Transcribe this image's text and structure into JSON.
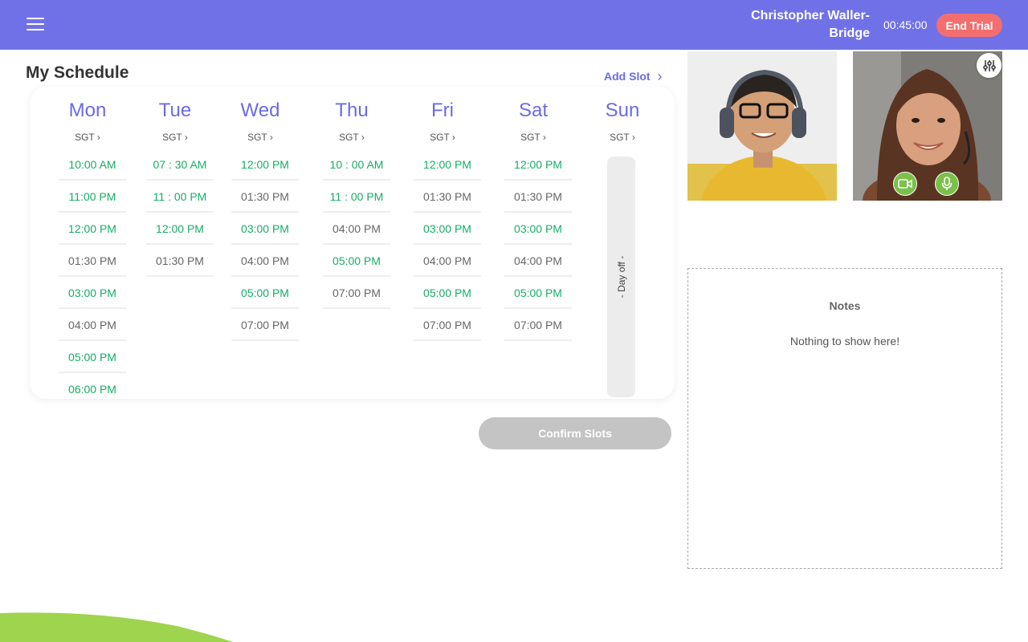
{
  "header": {
    "menu_icon": "hamburger-menu-icon",
    "user_name": "Christopher Waller-Bridge",
    "timer": "00:45:00",
    "end_trial_label": "End Trial",
    "background_color": "#7171e7",
    "end_trial_color": "#f36f6f"
  },
  "schedule": {
    "title": "My Schedule",
    "add_slot_label": "Add Slot",
    "confirm_label": "Confirm Slots",
    "days": [
      {
        "name": "Mon",
        "tz": "SGT",
        "slots": [
          {
            "time": "10:00 AM",
            "available": true
          },
          {
            "time": "11:00 PM",
            "available": true
          },
          {
            "time": "12:00 PM",
            "available": true
          },
          {
            "time": "01:30 PM",
            "available": false
          },
          {
            "time": "03:00 PM",
            "available": true
          },
          {
            "time": "04:00 PM",
            "available": false
          },
          {
            "time": "05:00 PM",
            "available": true
          },
          {
            "time": "06:00 PM",
            "available": true
          }
        ]
      },
      {
        "name": "Tue",
        "tz": "SGT",
        "slots": [
          {
            "time": "07 : 30 AM",
            "available": true
          },
          {
            "time": "11 : 00 PM",
            "available": true
          },
          {
            "time": "12:00 PM",
            "available": true
          },
          {
            "time": "01:30 PM",
            "available": false
          }
        ]
      },
      {
        "name": "Wed",
        "tz": "SGT",
        "slots": [
          {
            "time": "12:00 PM",
            "available": true
          },
          {
            "time": "01:30 PM",
            "available": false
          },
          {
            "time": "03:00 PM",
            "available": true
          },
          {
            "time": "04:00 PM",
            "available": false
          },
          {
            "time": "05:00 PM",
            "available": true
          },
          {
            "time": "07:00 PM",
            "available": false
          }
        ]
      },
      {
        "name": "Thu",
        "tz": "SGT",
        "slots": [
          {
            "time": "10 : 00 AM",
            "available": true
          },
          {
            "time": "11 : 00 PM",
            "available": true
          },
          {
            "time": "04:00 PM",
            "available": false
          },
          {
            "time": "05:00 PM",
            "available": true
          },
          {
            "time": "07:00 PM",
            "available": false
          }
        ]
      },
      {
        "name": "Fri",
        "tz": "SGT",
        "slots": [
          {
            "time": "12:00 PM",
            "available": true
          },
          {
            "time": "01:30 PM",
            "available": false
          },
          {
            "time": "03:00 PM",
            "available": true
          },
          {
            "time": "04:00 PM",
            "available": false
          },
          {
            "time": "05:00 PM",
            "available": true
          },
          {
            "time": "07:00 PM",
            "available": false
          }
        ]
      },
      {
        "name": "Sat",
        "tz": "SGT",
        "slots": [
          {
            "time": "12:00 PM",
            "available": true
          },
          {
            "time": "01:30 PM",
            "available": false
          },
          {
            "time": "03:00 PM",
            "available": true
          },
          {
            "time": "04:00 PM",
            "available": false
          },
          {
            "time": "05:00 PM",
            "available": true
          },
          {
            "time": "07:00 PM",
            "available": false
          }
        ]
      },
      {
        "name": "Sun",
        "tz": "SGT",
        "day_off_label": "- Day off -",
        "slots": []
      }
    ],
    "available_color": "#19ab68",
    "unavailable_color": "#666666",
    "day_color": "#6b6be5"
  },
  "video": {
    "student_feed": "student-video-feed",
    "teacher_feed": "teacher-video-feed",
    "camera_icon": "video-camera-icon",
    "mic_icon": "microphone-icon",
    "settings_icon": "sliders-settings-icon",
    "control_color": "#7ac04a"
  },
  "notes": {
    "title": "Notes",
    "empty_text": "Nothing to show here!"
  }
}
